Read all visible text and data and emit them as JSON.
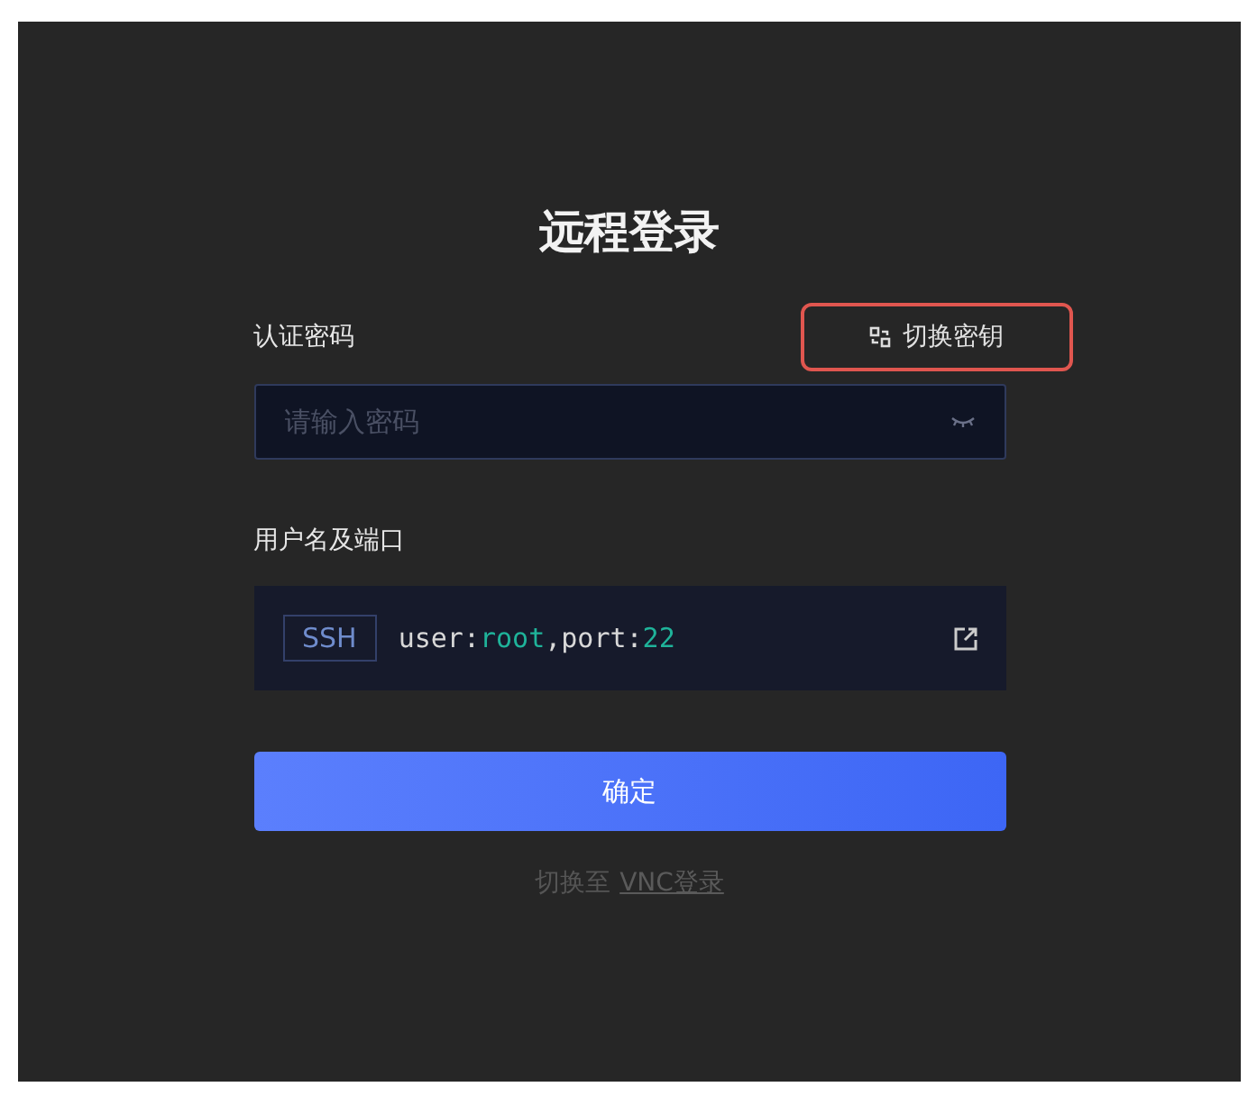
{
  "title": "远程登录",
  "password": {
    "label": "认证密码",
    "switch_link": "切换密钥",
    "highlighted": true,
    "placeholder": "请输入密码"
  },
  "account": {
    "label": "用户名及端口",
    "protocol": "SSH",
    "connection": [
      {
        "text": "user:",
        "kind": "key"
      },
      {
        "text": "root",
        "kind": "value"
      },
      {
        "text": ",port:",
        "kind": "key"
      },
      {
        "text": "22",
        "kind": "value"
      }
    ]
  },
  "confirm_button": "确定",
  "footer": {
    "prefix": "切换至",
    "link": "VNC登录"
  }
}
